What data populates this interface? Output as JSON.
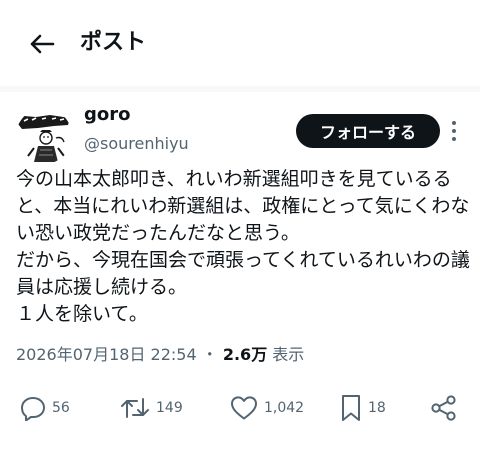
{
  "header": {
    "title": "ポスト",
    "back_icon": "arrow-left-icon"
  },
  "author": {
    "display_name": "goro",
    "handle": "@sourenhiyu",
    "avatar_icon": "avatar-illustration",
    "avatar_logo_text": "ぶりアニメ"
  },
  "follow_button": {
    "label": "フォローする"
  },
  "more_icon": "more-vertical-icon",
  "post": {
    "text": "今の山本太郎叩き、れいわ新選組叩きを見ているると、本当にれいわ新選組は、政権にとって気にくわない恐い政党だったんだなと思う。\nだから、今現在国会で頑張ってくれているれいわの議員は応援し続ける。\n１人を除いて。"
  },
  "meta": {
    "timestamp": "2026年07月18日 22:54",
    "separator": "・",
    "views_count": "2.6万",
    "views_label": "表示"
  },
  "actions": {
    "reply": {
      "icon": "reply-icon",
      "count": "56"
    },
    "repost": {
      "icon": "repost-icon",
      "count": "149"
    },
    "like": {
      "icon": "heart-icon",
      "count": "1,042"
    },
    "bookmark": {
      "icon": "bookmark-icon",
      "count": "18"
    },
    "share": {
      "icon": "share-icon"
    }
  },
  "colors": {
    "text": "#0f1419",
    "secondary": "#536471",
    "follow_bg": "#0f1419",
    "divider": "#f7f9f9"
  }
}
